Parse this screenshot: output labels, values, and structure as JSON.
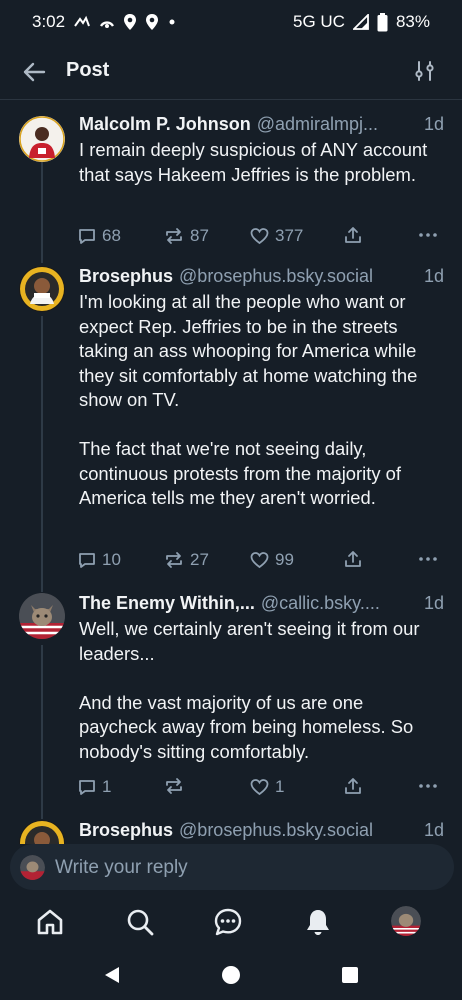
{
  "status": {
    "time": "3:02",
    "network": "5G UC",
    "battery": "83%"
  },
  "header": {
    "title": "Post"
  },
  "posts": [
    {
      "name": "Malcolm P. Johnson",
      "handle": "@admiralmpj...",
      "time": "1d",
      "text": "I remain deeply suspicious of ANY account that says Hakeem Jeffries is the problem.",
      "replies": "68",
      "reposts": "87",
      "likes": "377"
    },
    {
      "name": "Brosephus",
      "handle": "@brosephus.bsky.social",
      "time": "1d",
      "text": "I'm looking at all the people who want or expect Rep. Jeffries to be in the streets taking an ass whooping for America while they sit comfortably at home watching the show on TV.\n\nThe fact that we're not seeing daily, continuous protests from the majority of America tells me they aren't worried.",
      "replies": "10",
      "reposts": "27",
      "likes": "99"
    },
    {
      "name": "The Enemy Within,...",
      "handle": "@callic.bsky....",
      "time": "1d",
      "text": "Well, we certainly aren't seeing it from our leaders...\n\nAnd the vast majority of us are one paycheck away from being homeless. So nobody's sitting comfortably.",
      "replies": "1",
      "reposts": "",
      "likes": "1"
    },
    {
      "name": "Brosephus",
      "handle": "@brosephus.bsky.social",
      "time": "1d"
    }
  ],
  "reply": {
    "placeholder": "Write your reply"
  },
  "icons": {
    "back": "arrow-left-icon",
    "filter": "sliders-icon",
    "reply": "speech-bubble-icon",
    "repost": "repost-icon",
    "like": "heart-icon",
    "share": "share-icon",
    "more": "more-dots-icon"
  },
  "colors": {
    "background": "#161e27",
    "muted": "#8fa0b1",
    "accent": "#ffffff"
  }
}
